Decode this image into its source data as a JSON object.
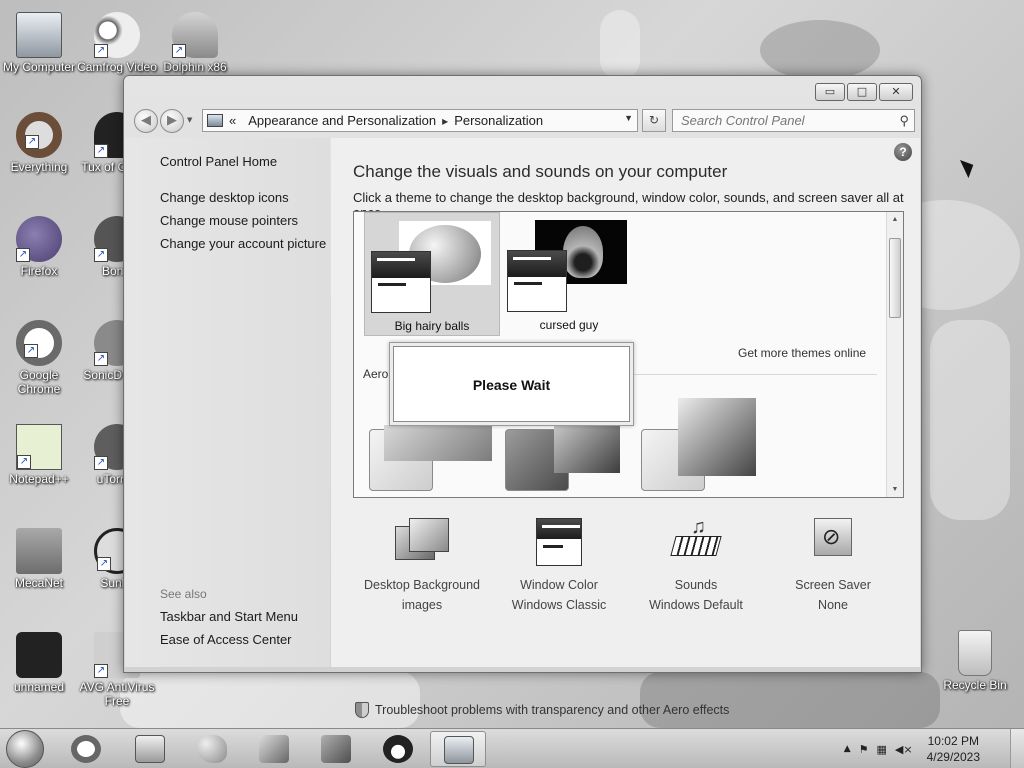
{
  "desktop": {
    "icons": [
      {
        "label": "My Computer"
      },
      {
        "label": "Camfrog Video"
      },
      {
        "label": "Dolphin x86"
      },
      {
        "label": "Everything"
      },
      {
        "label": "Tux of Comm"
      },
      {
        "label": "Firefox"
      },
      {
        "label": "Bonzi"
      },
      {
        "label": "Google Chrome"
      },
      {
        "label": "SonicD Shor"
      },
      {
        "label": "Notepad++"
      },
      {
        "label": "uTorren"
      },
      {
        "label": "MecaNet"
      },
      {
        "label": "Sunky"
      },
      {
        "label": "unnamed"
      },
      {
        "label": "AVG AntiVirus Free"
      },
      {
        "label": "Recycle Bin"
      }
    ]
  },
  "window": {
    "controls": {
      "minimize": "▭",
      "maximize": "□",
      "close": "✕"
    },
    "address": {
      "chevron": "«",
      "crumbs": [
        "Appearance and Personalization",
        "Personalization"
      ],
      "separator": "▸",
      "dropdown": "▼"
    },
    "refresh": "↻",
    "search": {
      "placeholder": "Search Control Panel",
      "icon": "⚲"
    }
  },
  "sidebar": {
    "home": "Control Panel Home",
    "links": [
      "Change desktop icons",
      "Change mouse pointers",
      "Change your account picture"
    ],
    "see_also_title": "See also",
    "see_also_links": [
      "Taskbar and Start Menu",
      "Ease of Access Center"
    ]
  },
  "content": {
    "help": "?",
    "heading": "Change the visuals and sounds on your computer",
    "subheading": "Click a theme to change the desktop background, window color, sounds, and screen saver all at once.",
    "themes": [
      {
        "name": "Big hairy balls",
        "selected": true
      },
      {
        "name": "cursed guy",
        "selected": false
      }
    ],
    "get_more": "Get more themes online",
    "group_label": "Aero",
    "dialog": {
      "text": "Please Wait"
    },
    "settings": [
      {
        "title": "Desktop Background",
        "value": "images",
        "icon": "desktop-background-icon"
      },
      {
        "title": "Window Color",
        "value": "Windows Classic",
        "icon": "window-color-icon"
      },
      {
        "title": "Sounds",
        "value": "Windows Default",
        "icon": "sounds-icon"
      },
      {
        "title": "Screen Saver",
        "value": "None",
        "icon": "screen-saver-icon"
      }
    ],
    "troubleshoot": "Troubleshoot problems with transparency and other Aero effects"
  },
  "taskbar": {
    "apps": [
      "explorer",
      "chrome",
      "scanner",
      "paint",
      "tools",
      "photo",
      "tux",
      "control-panel"
    ],
    "tray": {
      "up_arrow": "▲",
      "time": "10:02 PM",
      "date": "4/29/2023"
    }
  }
}
